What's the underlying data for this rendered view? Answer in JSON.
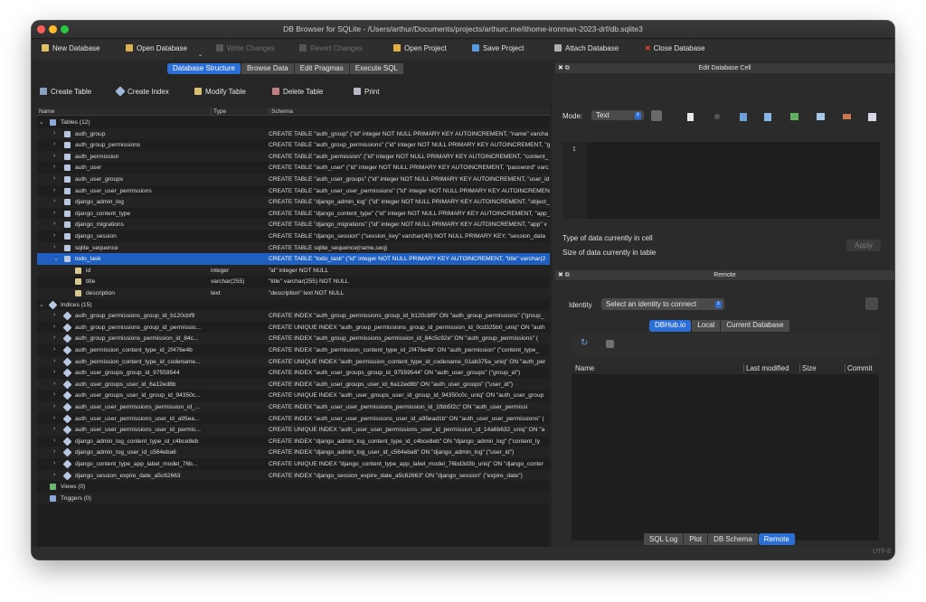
{
  "window": {
    "title": "DB Browser for SQLite - /Users/arthur/Documents/projects/arthurc.me/ithome-ironman-2023-drf/db.sqlite3"
  },
  "toolbar": [
    {
      "label": "New Database",
      "enabled": true
    },
    {
      "label": "Open Database",
      "enabled": true
    },
    {
      "label": "Write Changes",
      "enabled": false
    },
    {
      "label": "Revert Changes",
      "enabled": false
    },
    {
      "label": "Open Project",
      "enabled": true
    },
    {
      "label": "Save Project",
      "enabled": true
    },
    {
      "label": "Attach Database",
      "enabled": true
    },
    {
      "label": "Close Database",
      "enabled": true
    }
  ],
  "main_tabs": [
    "Database Structure",
    "Browse Data",
    "Edit Pragmas",
    "Execute SQL"
  ],
  "active_main_tab": "Database Structure",
  "actions": [
    "Create Table",
    "Create Index",
    "Modify Table",
    "Delete Table",
    "Print"
  ],
  "tree": {
    "columns": [
      "Name",
      "Type",
      "Schema"
    ],
    "rows": [
      {
        "depth": 0,
        "chev": "v",
        "kind": "folder",
        "name": "Tables (12)",
        "type": "",
        "schema": ""
      },
      {
        "depth": 1,
        "chev": ">",
        "kind": "table",
        "name": "auth_group",
        "type": "",
        "schema": "CREATE TABLE \"auth_group\" (\"id\" integer NOT NULL PRIMARY KEY AUTOINCREMENT, \"name\" varcha"
      },
      {
        "depth": 1,
        "chev": ">",
        "kind": "table",
        "name": "auth_group_permissions",
        "type": "",
        "schema": "CREATE TABLE \"auth_group_permissions\" (\"id\" integer NOT NULL PRIMARY KEY AUTOINCREMENT, \"g"
      },
      {
        "depth": 1,
        "chev": ">",
        "kind": "table",
        "name": "auth_permission",
        "type": "",
        "schema": "CREATE TABLE \"auth_permission\" (\"id\" integer NOT NULL PRIMARY KEY AUTOINCREMENT, \"content_"
      },
      {
        "depth": 1,
        "chev": ">",
        "kind": "table",
        "name": "auth_user",
        "type": "",
        "schema": "CREATE TABLE \"auth_user\" (\"id\" integer NOT NULL PRIMARY KEY AUTOINCREMENT, \"password\" varc"
      },
      {
        "depth": 1,
        "chev": ">",
        "kind": "table",
        "name": "auth_user_groups",
        "type": "",
        "schema": "CREATE TABLE \"auth_user_groups\" (\"id\" integer NOT NULL PRIMARY KEY AUTOINCREMENT, \"user_id"
      },
      {
        "depth": 1,
        "chev": ">",
        "kind": "table",
        "name": "auth_user_user_permissions",
        "type": "",
        "schema": "CREATE TABLE \"auth_user_user_permissions\" (\"id\" integer NOT NULL PRIMARY KEY AUTOINCREMEN"
      },
      {
        "depth": 1,
        "chev": ">",
        "kind": "table",
        "name": "django_admin_log",
        "type": "",
        "schema": "CREATE TABLE \"django_admin_log\" (\"id\" integer NOT NULL PRIMARY KEY AUTOINCREMENT, \"object_"
      },
      {
        "depth": 1,
        "chev": ">",
        "kind": "table",
        "name": "django_content_type",
        "type": "",
        "schema": "CREATE TABLE \"django_content_type\" (\"id\" integer NOT NULL PRIMARY KEY AUTOINCREMENT, \"app_"
      },
      {
        "depth": 1,
        "chev": ">",
        "kind": "table",
        "name": "django_migrations",
        "type": "",
        "schema": "CREATE TABLE \"django_migrations\" (\"id\" integer NOT NULL PRIMARY KEY AUTOINCREMENT, \"app\" v"
      },
      {
        "depth": 1,
        "chev": ">",
        "kind": "table",
        "name": "django_session",
        "type": "",
        "schema": "CREATE TABLE \"django_session\" (\"session_key\" varchar(40) NOT NULL PRIMARY KEY, \"session_data"
      },
      {
        "depth": 1,
        "chev": ">",
        "kind": "table",
        "name": "sqlite_sequence",
        "type": "",
        "schema": "CREATE TABLE sqlite_sequence(name,seq)"
      },
      {
        "depth": 1,
        "chev": "v",
        "kind": "table",
        "name": "todo_task",
        "type": "",
        "schema": "CREATE TABLE \"todo_task\" (\"id\" integer NOT NULL PRIMARY KEY AUTOINCREMENT, \"title\" varchar(2",
        "selected": true
      },
      {
        "depth": 2,
        "chev": "",
        "kind": "field",
        "name": "id",
        "type": "integer",
        "schema": "\"id\" integer NOT NULL"
      },
      {
        "depth": 2,
        "chev": "",
        "kind": "field",
        "name": "title",
        "type": "varchar(255)",
        "schema": "\"title\" varchar(255) NOT NULL"
      },
      {
        "depth": 2,
        "chev": "",
        "kind": "field",
        "name": "description",
        "type": "text",
        "schema": "\"description\" text NOT NULL"
      },
      {
        "depth": 0,
        "chev": "v",
        "kind": "index",
        "name": "Indices (15)",
        "type": "",
        "schema": ""
      },
      {
        "depth": 1,
        "chev": ">",
        "kind": "index",
        "name": "auth_group_permissions_group_id_b120cbf9",
        "type": "",
        "schema": "CREATE INDEX \"auth_group_permissions_group_id_b120cbf9\" ON \"auth_group_permissions\" (\"group_"
      },
      {
        "depth": 1,
        "chev": ">",
        "kind": "index",
        "name": "auth_group_permissions_group_id_permissio...",
        "type": "",
        "schema": "CREATE UNIQUE INDEX \"auth_group_permissions_group_id_permission_id_0cd325b0_uniq\" ON \"auth"
      },
      {
        "depth": 1,
        "chev": ">",
        "kind": "index",
        "name": "auth_group_permissions_permission_id_84c...",
        "type": "",
        "schema": "CREATE INDEX \"auth_group_permissions_permission_id_84c5c92e\" ON \"auth_group_permissions\" ("
      },
      {
        "depth": 1,
        "chev": ">",
        "kind": "index",
        "name": "auth_permission_content_type_id_2f476e4b",
        "type": "",
        "schema": "CREATE INDEX \"auth_permission_content_type_id_2f476e4b\" ON \"auth_permission\" (\"content_type_"
      },
      {
        "depth": 1,
        "chev": ">",
        "kind": "index",
        "name": "auth_permission_content_type_id_codename...",
        "type": "",
        "schema": "CREATE UNIQUE INDEX \"auth_permission_content_type_id_codename_01ab375a_uniq\" ON \"auth_per"
      },
      {
        "depth": 1,
        "chev": ">",
        "kind": "index",
        "name": "auth_user_groups_group_id_97559544",
        "type": "",
        "schema": "CREATE INDEX \"auth_user_groups_group_id_97559544\" ON \"auth_user_groups\" (\"group_id\")"
      },
      {
        "depth": 1,
        "chev": ">",
        "kind": "index",
        "name": "auth_user_groups_user_id_6a12ed8b",
        "type": "",
        "schema": "CREATE INDEX \"auth_user_groups_user_id_6a12ed8b\" ON \"auth_user_groups\" (\"user_id\")"
      },
      {
        "depth": 1,
        "chev": ">",
        "kind": "index",
        "name": "auth_user_groups_user_id_group_id_94350c...",
        "type": "",
        "schema": "CREATE UNIQUE INDEX \"auth_user_groups_user_id_group_id_94350c0c_uniq\" ON \"auth_user_group"
      },
      {
        "depth": 1,
        "chev": ">",
        "kind": "index",
        "name": "auth_user_user_permissions_permission_id_...",
        "type": "",
        "schema": "CREATE INDEX \"auth_user_user_permissions_permission_id_1fbb5f2c\" ON \"auth_user_permissi"
      },
      {
        "depth": 1,
        "chev": ">",
        "kind": "index",
        "name": "auth_user_user_permissions_user_id_a95ea...",
        "type": "",
        "schema": "CREATE INDEX \"auth_user_user_permissions_user_id_a95ead1b\" ON \"auth_user_user_permissions\" ("
      },
      {
        "depth": 1,
        "chev": ">",
        "kind": "index",
        "name": "auth_user_user_permissions_user_id_permis...",
        "type": "",
        "schema": "CREATE UNIQUE INDEX \"auth_user_user_permissions_user_id_permission_id_14a6b632_uniq\" ON \"a"
      },
      {
        "depth": 1,
        "chev": ">",
        "kind": "index",
        "name": "django_admin_log_content_type_id_c4bce8eb",
        "type": "",
        "schema": "CREATE INDEX \"django_admin_log_content_type_id_c4bce8eb\" ON \"django_admin_log\" (\"content_ty"
      },
      {
        "depth": 1,
        "chev": ">",
        "kind": "index",
        "name": "django_admin_log_user_id_c564eba6",
        "type": "",
        "schema": "CREATE INDEX \"django_admin_log_user_id_c564eba6\" ON \"django_admin_log\" (\"user_id\")"
      },
      {
        "depth": 1,
        "chev": ">",
        "kind": "index",
        "name": "django_content_type_app_label_model_76b...",
        "type": "",
        "schema": "CREATE UNIQUE INDEX \"django_content_type_app_label_model_76bd3d3b_uniq\" ON \"django_conter"
      },
      {
        "depth": 1,
        "chev": ">",
        "kind": "index",
        "name": "django_session_expire_date_a5c62663",
        "type": "",
        "schema": "CREATE INDEX \"django_session_expire_date_a5c62663\" ON \"django_session\" (\"expire_date\")"
      },
      {
        "depth": 0,
        "chev": "",
        "kind": "view",
        "name": "Views (0)",
        "type": "",
        "schema": ""
      },
      {
        "depth": 0,
        "chev": "",
        "kind": "trigger",
        "name": "Triggers (0)",
        "type": "",
        "schema": ""
      }
    ]
  },
  "edit_cell": {
    "title": "Edit Database Cell",
    "mode_label": "Mode:",
    "mode_value": "Text",
    "line_number": "1",
    "type_label": "Type of data currently in cell",
    "size_label": "Size of data currently in table",
    "apply_label": "Apply"
  },
  "remote": {
    "title": "Remote",
    "identity_label": "Identity",
    "identity_placeholder": "Select an identity to connect",
    "tabs": [
      "DBHub.io",
      "Local",
      "Current Database"
    ],
    "active_tab": "DBHub.io",
    "columns": [
      "Name",
      "Last modified",
      "Size",
      "Commit"
    ]
  },
  "bottom_tabs": [
    "SQL Log",
    "Plot",
    "DB Schema",
    "Remote"
  ],
  "active_bottom_tab": "Remote",
  "status": {
    "encoding": "UTF-8"
  },
  "colors": {
    "accent": "#2b6fd6",
    "close_red": "#ff5f57",
    "minimize_yellow": "#febc2e",
    "zoom_green": "#28c840"
  }
}
